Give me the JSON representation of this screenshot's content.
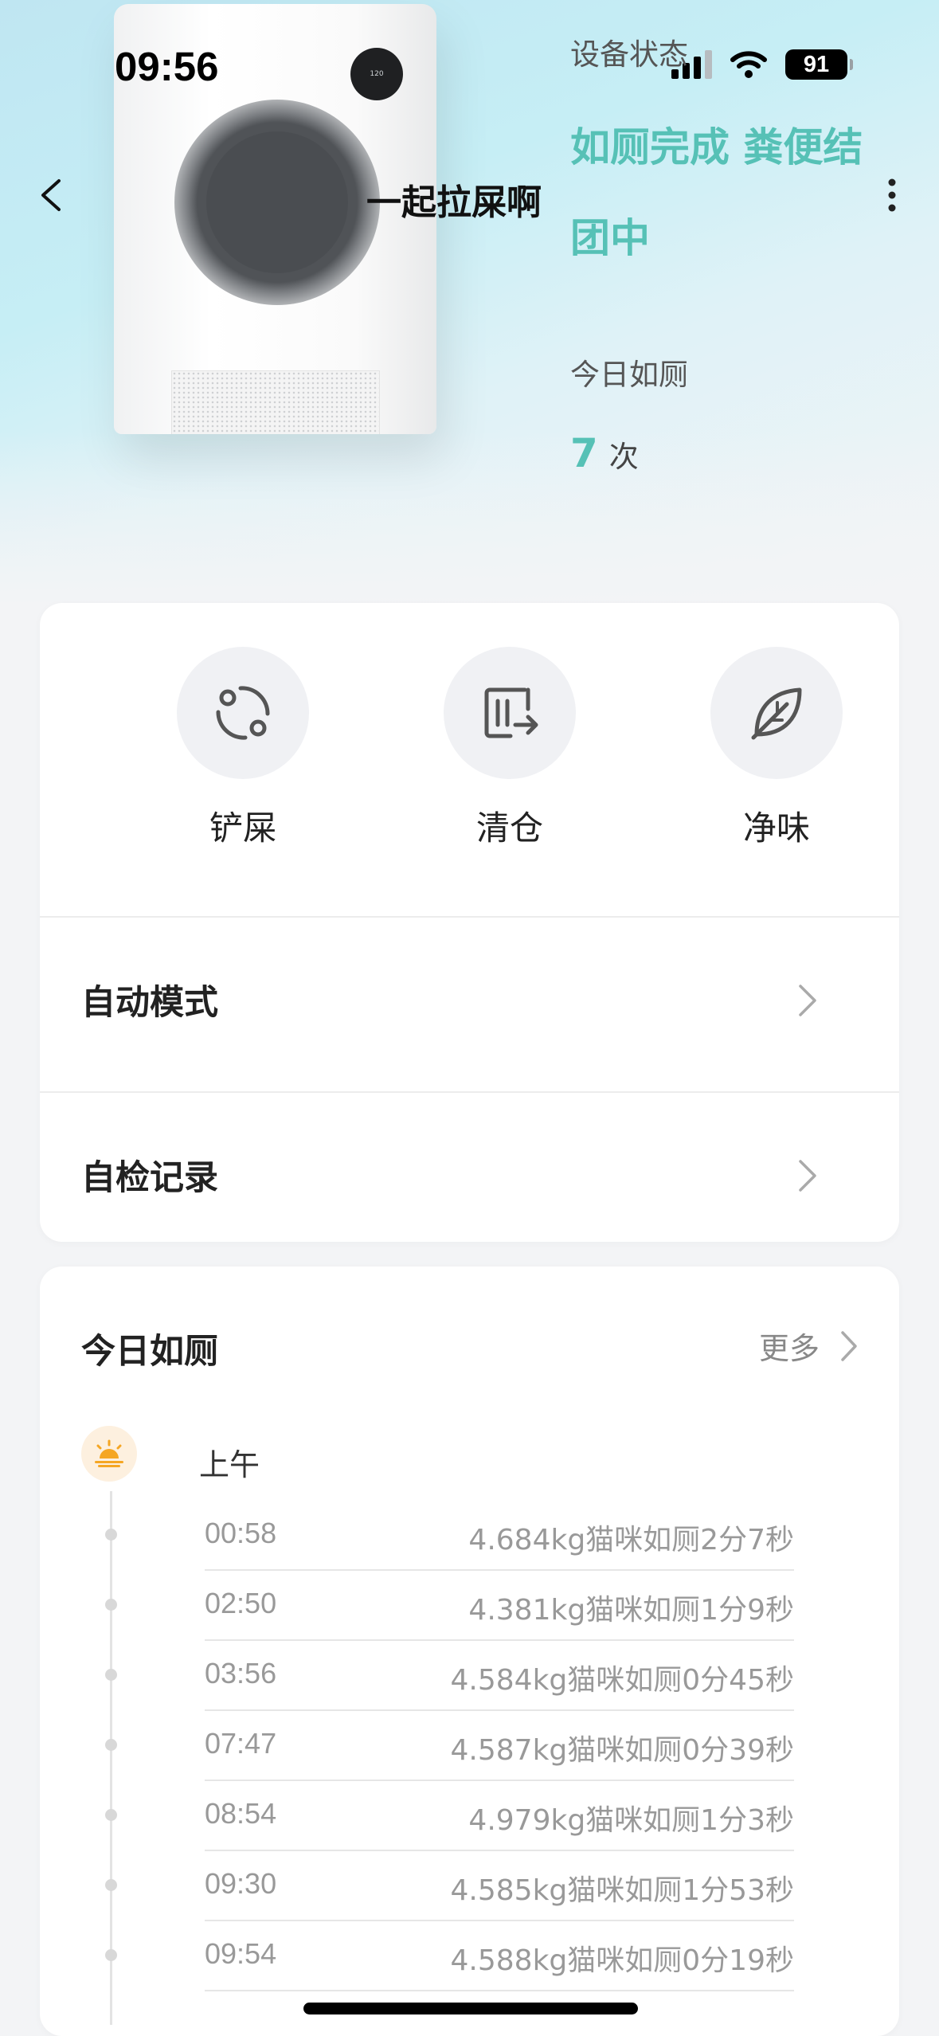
{
  "status_bar": {
    "time": "09:56",
    "battery": "91"
  },
  "header": {
    "device_name": "一起拉屎啊"
  },
  "device_screen_text": "120",
  "device_state": {
    "label": "设备状态",
    "value": "如厕完成 粪便结团中"
  },
  "today_summary": {
    "label": "今日如厕",
    "count": "7",
    "unit": "次"
  },
  "actions": [
    {
      "label": "铲屎",
      "icon": "refresh-cycle-icon"
    },
    {
      "label": "清仓",
      "icon": "empty-bin-icon"
    },
    {
      "label": "净味",
      "icon": "leaf-icon"
    }
  ],
  "menu": [
    {
      "label": "自动模式"
    },
    {
      "label": "自检记录"
    }
  ],
  "log": {
    "title": "今日如厕",
    "more": "更多",
    "period": "上午",
    "records": [
      {
        "time": "00:58",
        "desc": "4.684kg猫咪如厕2分7秒"
      },
      {
        "time": "02:50",
        "desc": "4.381kg猫咪如厕1分9秒"
      },
      {
        "time": "03:56",
        "desc": "4.584kg猫咪如厕0分45秒"
      },
      {
        "time": "07:47",
        "desc": "4.587kg猫咪如厕0分39秒"
      },
      {
        "time": "08:54",
        "desc": "4.979kg猫咪如厕1分3秒"
      },
      {
        "time": "09:30",
        "desc": "4.585kg猫咪如厕1分53秒"
      },
      {
        "time": "09:54",
        "desc": "4.588kg猫咪如厕0分19秒"
      }
    ]
  },
  "colors": {
    "accent": "#56c1b6",
    "sun": "#f5a623"
  }
}
